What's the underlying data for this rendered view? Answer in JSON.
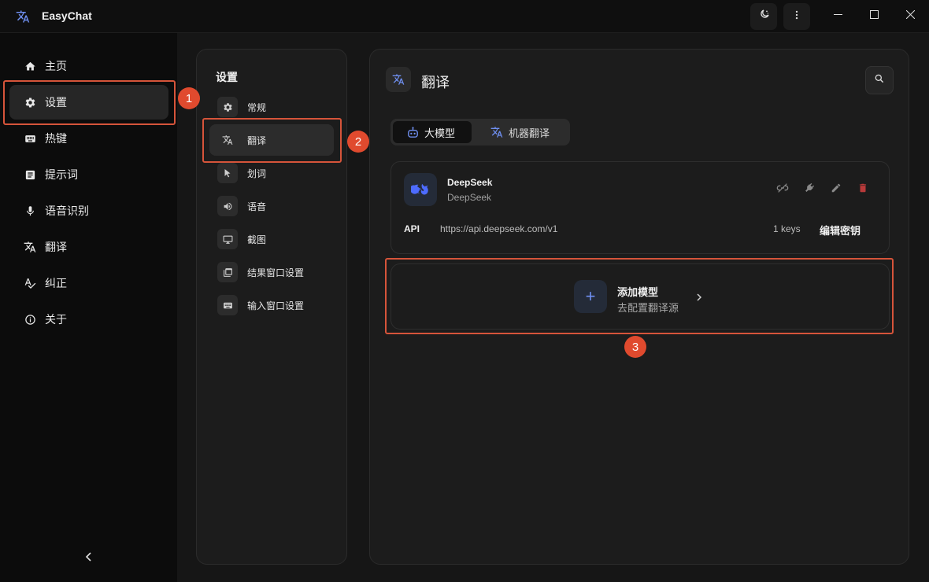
{
  "app": {
    "title": "EasyChat"
  },
  "titlebar": {
    "theme_icon": "moon-sun-icon",
    "more_icon": "more-vertical-icon"
  },
  "sidebar": {
    "items": [
      {
        "label": "主页",
        "icon": "home-icon"
      },
      {
        "label": "设置",
        "icon": "gear-icon",
        "active": true
      },
      {
        "label": "热键",
        "icon": "keyboard-icon"
      },
      {
        "label": "提示词",
        "icon": "document-icon"
      },
      {
        "label": "语音识别",
        "icon": "mic-icon"
      },
      {
        "label": "翻译",
        "icon": "translate-icon"
      },
      {
        "label": "纠正",
        "icon": "spellcheck-icon"
      },
      {
        "label": "关于",
        "icon": "info-icon"
      }
    ]
  },
  "settings_panel": {
    "title": "设置",
    "items": [
      {
        "label": "常规",
        "icon": "gear-icon"
      },
      {
        "label": "翻译",
        "icon": "translate-icon",
        "active": true
      },
      {
        "label": "划词",
        "icon": "cursor-icon"
      },
      {
        "label": "语音",
        "icon": "speaker-icon"
      },
      {
        "label": "截图",
        "icon": "monitor-icon"
      },
      {
        "label": "结果窗口设置",
        "icon": "window-icon"
      },
      {
        "label": "输入窗口设置",
        "icon": "keyboard-icon"
      }
    ]
  },
  "main": {
    "title": "翻译",
    "tabs": [
      {
        "label": "大模型",
        "icon": "robot-icon",
        "active": true
      },
      {
        "label": "机器翻译",
        "icon": "translate-icon"
      }
    ],
    "model_card": {
      "name": "DeepSeek",
      "provider": "DeepSeek",
      "api_label": "API",
      "api_url": "https://api.deepseek.com/v1",
      "keys": "1 keys",
      "edit_keys_label": "编辑密钥"
    },
    "add_card": {
      "title": "添加模型",
      "subtitle": "去配置翻译源",
      "plus": "+"
    }
  },
  "annotations": [
    "1",
    "2",
    "3"
  ],
  "colors": {
    "accent": "#5b7ff0",
    "annotation": "#e04a2e",
    "delete": "#b83a3a"
  }
}
